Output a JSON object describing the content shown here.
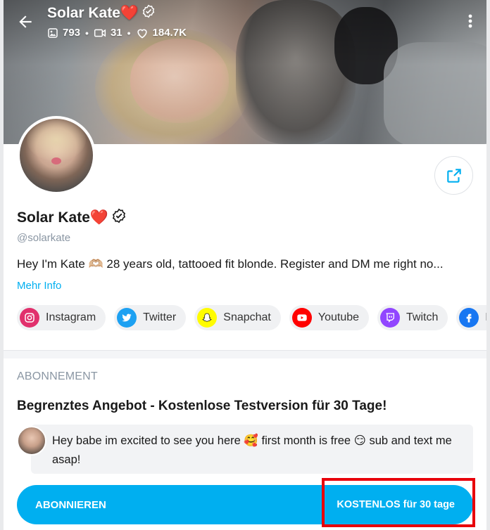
{
  "header": {
    "name": "Solar Kate❤️",
    "stats": {
      "photos": "793",
      "videos": "31",
      "likes": "184.7K"
    },
    "separator": "•"
  },
  "profile": {
    "name": "Solar Kate❤️",
    "handle": "@solarkate",
    "bio": "Hey I'm Kate 🫶🏼 28 years old, tattooed fit blonde. Register and DM me right no...",
    "more_label": "Mehr Info"
  },
  "socials": [
    {
      "label": "Instagram",
      "icon": "instagram-icon",
      "color": "#e1306c"
    },
    {
      "label": "Twitter",
      "icon": "twitter-icon",
      "color": "#1da1f2"
    },
    {
      "label": "Snapchat",
      "icon": "snapchat-icon",
      "color": "#fffc00"
    },
    {
      "label": "Youtube",
      "icon": "youtube-icon",
      "color": "#ff0000"
    },
    {
      "label": "Twitch",
      "icon": "twitch-icon",
      "color": "#9146ff"
    },
    {
      "label": "Fa",
      "icon": "facebook-icon",
      "color": "#1877f2"
    }
  ],
  "subscription": {
    "heading": "ABONNEMENT",
    "offer": "Begrenztes Angebot - Kostenlose Testversion für 30 Tage!",
    "message": "Hey babe im excited to see you here 🥰 first month is free 😏 sub and text me asap!",
    "button_left": "ABONNIEREN",
    "button_right": "KOSTENLOS für 30 tage"
  },
  "colors": {
    "accent": "#00aff0",
    "highlight": "#e8000b",
    "muted": "#8a96a3"
  }
}
